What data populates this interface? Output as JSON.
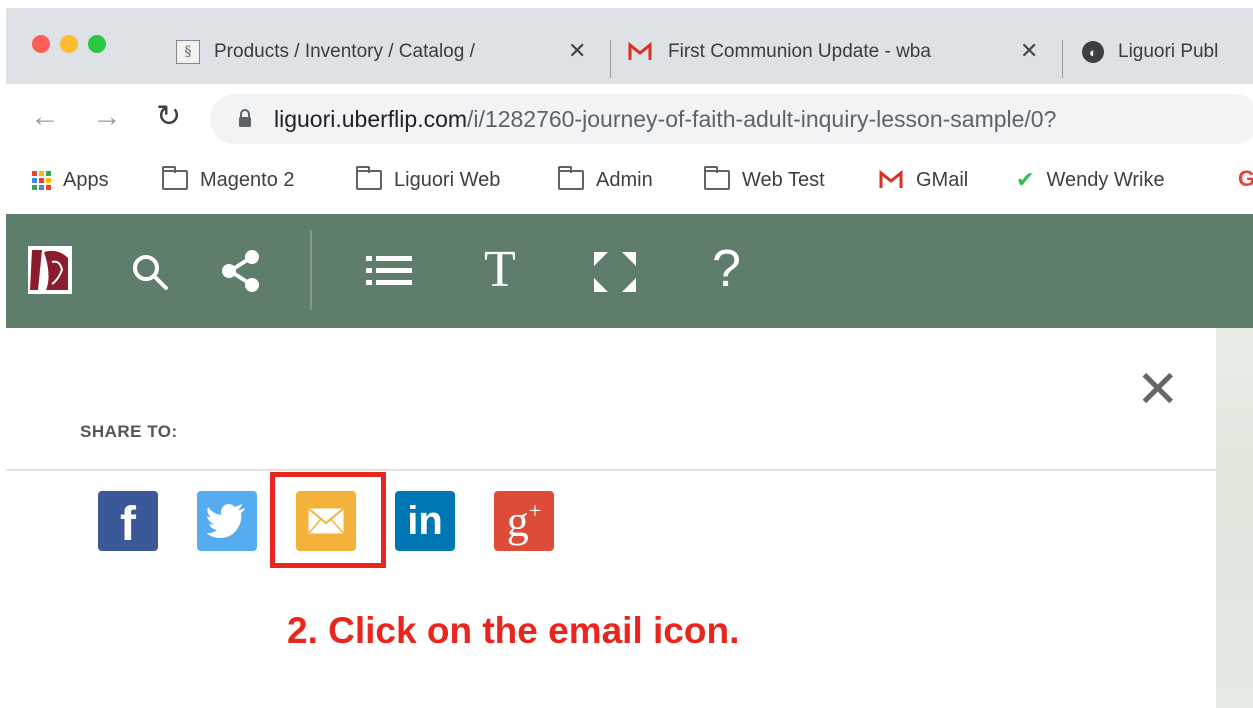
{
  "browser": {
    "tabs": [
      {
        "title": "Products / Inventory / Catalog /",
        "favicon": "liguori-icon"
      },
      {
        "title": "First Communion Update - wba",
        "favicon": "gmail-icon"
      },
      {
        "title": "Liguori Publ",
        "favicon": "globe-icon"
      }
    ],
    "url": {
      "host": "liguori.uberflip.com",
      "path": "/i/1282760-journey-of-faith-adult-inquiry-lesson-sample/0?"
    },
    "bookmarks": [
      {
        "label": "Apps",
        "icon": "apps-grid-icon"
      },
      {
        "label": "Magento 2",
        "icon": "folder-icon"
      },
      {
        "label": "Liguori Web",
        "icon": "folder-icon"
      },
      {
        "label": "Admin",
        "icon": "folder-icon"
      },
      {
        "label": "Web Test",
        "icon": "folder-icon"
      },
      {
        "label": "GMail",
        "icon": "gmail-icon"
      },
      {
        "label": "Wendy Wrike",
        "icon": "check-icon"
      }
    ]
  },
  "viewer_toolbar": {
    "background": "#5e7e6b",
    "icons": [
      "logo",
      "search-icon",
      "share-icon",
      "list-icon",
      "text-size-icon",
      "fullscreen-icon",
      "help-icon"
    ],
    "text_icon_label": "T",
    "help_label": "?"
  },
  "share_panel": {
    "title": "SHARE TO:",
    "close_label": "✕",
    "buttons": [
      {
        "name": "facebook",
        "glyph": "f",
        "color": "#3b5998"
      },
      {
        "name": "twitter",
        "color": "#55acee"
      },
      {
        "name": "email",
        "color": "#f5b23b"
      },
      {
        "name": "linkedin",
        "glyph": "in",
        "color": "#0077b5"
      },
      {
        "name": "google-plus",
        "glyph": "g",
        "superscript": "+",
        "color": "#dd4b39"
      }
    ]
  },
  "annotation": {
    "text": "2. Click on the email icon.",
    "color": "#e8261d"
  }
}
